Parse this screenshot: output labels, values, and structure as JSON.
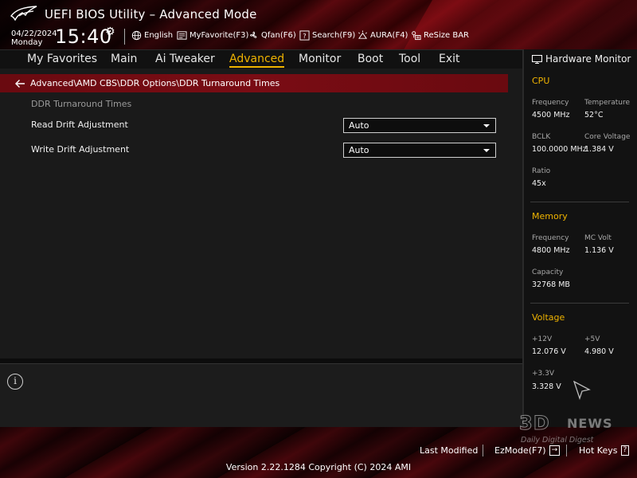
{
  "header": {
    "title": "UEFI BIOS Utility – Advanced Mode",
    "date": "04/22/2024",
    "day": "Monday",
    "time": "15:40",
    "buttons": [
      {
        "label": "English",
        "icon": "globe-icon"
      },
      {
        "label": "MyFavorite(F3)",
        "icon": "favorite-list-icon"
      },
      {
        "label": "Qfan(F6)",
        "icon": "fan-icon"
      },
      {
        "label": "Search(F9)",
        "icon": "search-help-icon"
      },
      {
        "label": "AURA(F4)",
        "icon": "aura-light-icon"
      },
      {
        "label": "ReSize BAR",
        "icon": "resize-bar-icon"
      }
    ]
  },
  "nav": {
    "items": [
      "My Favorites",
      "Main",
      "Ai Tweaker",
      "Advanced",
      "Monitor",
      "Boot",
      "Tool",
      "Exit"
    ],
    "active": "Advanced"
  },
  "breadcrumb": {
    "path": "Advanced\\AMD CBS\\DDR Options\\DDR Turnaround Times"
  },
  "main": {
    "section_title": "DDR Turnaround Times",
    "settings": [
      {
        "label": "Read Drift Adjustment",
        "value": "Auto"
      },
      {
        "label": "Write Drift Adjustment",
        "value": "Auto"
      }
    ]
  },
  "info": {
    "icon": "info-icon",
    "glyph": "i"
  },
  "hw_monitor": {
    "title": "Hardware Monitor",
    "cpu": {
      "title": "CPU",
      "frequency_label": "Frequency",
      "frequency": "4500 MHz",
      "temperature_label": "Temperature",
      "temperature": "52°C",
      "bclk_label": "BCLK",
      "bclk": "100.0000 MHz",
      "core_voltage_label": "Core Voltage",
      "core_voltage": "1.384 V",
      "ratio_label": "Ratio",
      "ratio": "45x"
    },
    "memory": {
      "title": "Memory",
      "frequency_label": "Frequency",
      "frequency": "4800 MHz",
      "mc_volt_label": "MC Volt",
      "mc_volt": "1.136 V",
      "capacity_label": "Capacity",
      "capacity": "32768 MB"
    },
    "voltage": {
      "title": "Voltage",
      "v12_label": "+12V",
      "v12": "12.076 V",
      "v5_label": "+5V",
      "v5": "4.980 V",
      "v33_label": "+3.3V",
      "v33": "3.328 V"
    }
  },
  "footer": {
    "last_modified": "Last Modified",
    "ezmode": "EzMode(F7)",
    "ezmode_key": "→",
    "hot_keys": "Hot Keys",
    "hot_keys_key": "?",
    "version": "Version 2.22.1284 Copyright (C) 2024 AMI"
  },
  "watermark": {
    "brand_a": "3D",
    "brand_b": "NEWS",
    "tagline": "Daily Digital Digest"
  },
  "colors": {
    "accent": "#f0b400",
    "header_red": "#7a0c14",
    "panel_bg": "#1a1a1a"
  }
}
